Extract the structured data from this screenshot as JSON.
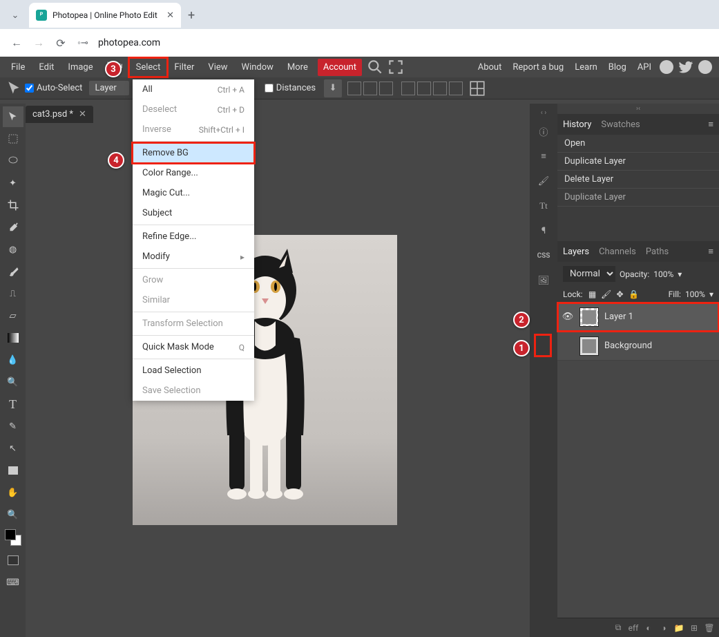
{
  "browser": {
    "tab_title": "Photopea | Online Photo Edit",
    "url": "photopea.com"
  },
  "menus": [
    "File",
    "Edit",
    "Image",
    "Layer",
    "Select",
    "Filter",
    "View",
    "Window",
    "More"
  ],
  "menu_account": "Account",
  "menu_right": [
    "About",
    "Report a bug",
    "Learn",
    "Blog",
    "API"
  ],
  "options": {
    "auto_select": "Auto-Select",
    "layer": "Layer",
    "distances": "Distances"
  },
  "doc_tab": "cat3.psd *",
  "dropdown": [
    {
      "label": "All",
      "short": "Ctrl + A",
      "disabled": false
    },
    {
      "label": "Deselect",
      "short": "Ctrl + D",
      "disabled": true
    },
    {
      "label": "Inverse",
      "short": "Shift+Ctrl + I",
      "disabled": true
    },
    {
      "sep": true
    },
    {
      "label": "Remove BG",
      "hl": true
    },
    {
      "label": "Color Range..."
    },
    {
      "label": "Magic Cut..."
    },
    {
      "label": "Subject"
    },
    {
      "sep": true
    },
    {
      "label": "Refine Edge..."
    },
    {
      "label": "Modify",
      "sub": true
    },
    {
      "sep": true
    },
    {
      "label": "Grow",
      "disabled": true
    },
    {
      "label": "Similar",
      "disabled": true
    },
    {
      "sep": true
    },
    {
      "label": "Transform Selection",
      "disabled": true
    },
    {
      "sep": true
    },
    {
      "label": "Quick Mask Mode",
      "short": "Q"
    },
    {
      "sep": true
    },
    {
      "label": "Load Selection"
    },
    {
      "label": "Save Selection",
      "disabled": true
    }
  ],
  "history": {
    "tabs": [
      "History",
      "Swatches"
    ],
    "items": [
      "Open",
      "Duplicate Layer",
      "Delete Layer",
      "Duplicate Layer"
    ]
  },
  "layers_panel": {
    "tabs": [
      "Layers",
      "Channels",
      "Paths"
    ],
    "blend": "Normal",
    "opacity_label": "Opacity:",
    "opacity": "100%",
    "lock_label": "Lock:",
    "fill_label": "Fill:",
    "fill": "100%",
    "layers": [
      {
        "name": "Layer 1",
        "visible": true,
        "active": true
      },
      {
        "name": "Background",
        "visible": false,
        "active": false
      }
    ],
    "bottom_label": "eff"
  },
  "steps": {
    "s1": "1",
    "s2": "2",
    "s3": "3",
    "s4": "4"
  }
}
